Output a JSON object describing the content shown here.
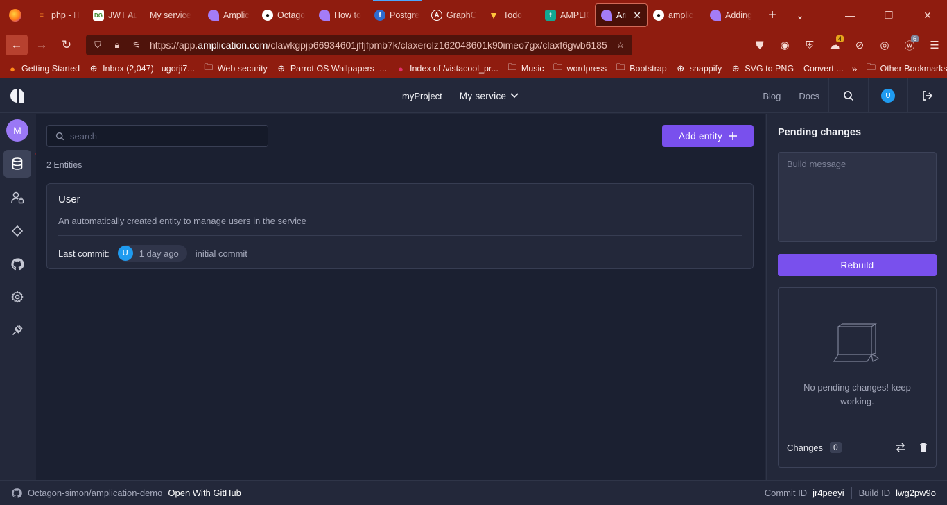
{
  "browser": {
    "tabs": [
      {
        "label": "php - H",
        "favicon": "stackoverflow-icon",
        "color": "#f48024"
      },
      {
        "label": "JWT Au",
        "favicon": "dg-icon",
        "color": "#3a8a2c"
      },
      {
        "label": "My service",
        "favicon": "none",
        "color": ""
      },
      {
        "label": "Amplic",
        "favicon": "amplication-icon",
        "color": "#a47cf7"
      },
      {
        "label": "Octago",
        "favicon": "github-icon",
        "color": "#ffffff"
      },
      {
        "label": "How to",
        "favicon": "amplication-icon",
        "color": "#a47cf7"
      },
      {
        "label": "Postgre",
        "favicon": "postgres-icon",
        "color": "#2f6cd0"
      },
      {
        "label": "GraphC",
        "favicon": "apollo-icon",
        "color": "#ffffff"
      },
      {
        "label": "Todo",
        "favicon": "vite-icon",
        "color": "#bd34fe"
      },
      {
        "label": "AMPLIC",
        "favicon": "t-icon",
        "color": "#13a892"
      },
      {
        "label": "Amp",
        "favicon": "amplication-icon",
        "color": "#a47cf7",
        "active": true
      },
      {
        "label": "amplic",
        "favicon": "github-icon",
        "color": "#ffffff"
      },
      {
        "label": "Adding",
        "favicon": "amplication-icon",
        "color": "#a47cf7"
      }
    ],
    "url_prefix": "https://app.",
    "url_host": "amplication.com",
    "url_path": "/clawkgpjp66934601jffjfpmb7k/claxerolz162048601k90imeo7gx/claxf6gwb6185",
    "extension_badges": {
      "ext3": "4",
      "ext7": "6"
    },
    "bookmarks": [
      {
        "label": "Getting Started",
        "icon": "firefox-icon"
      },
      {
        "label": "Inbox (2,047) - ugorji7...",
        "icon": "globe-icon"
      },
      {
        "label": "Web security",
        "icon": "folder-icon"
      },
      {
        "label": "Parrot OS Wallpapers -...",
        "icon": "globe-icon"
      },
      {
        "label": "Index of /vistacool_pr...",
        "icon": "berry-icon"
      },
      {
        "label": "Music",
        "icon": "folder-icon"
      },
      {
        "label": "wordpress",
        "icon": "folder-icon"
      },
      {
        "label": "Bootstrap",
        "icon": "folder-icon"
      },
      {
        "label": "snappify",
        "icon": "globe-icon"
      },
      {
        "label": "SVG to PNG – Convert ...",
        "icon": "globe-icon"
      }
    ],
    "other_bookmarks": "Other Bookmarks"
  },
  "header": {
    "project": "myProject",
    "service": "My service",
    "blog": "Blog",
    "docs": "Docs",
    "user_initial": "U"
  },
  "sidebar": {
    "workspace_initial": "M"
  },
  "main": {
    "search_placeholder": "search",
    "add_entity_label": "Add entity",
    "entity_count": "2 Entities",
    "entities": [
      {
        "name": "User",
        "description": "An automatically created entity to manage users in the service",
        "last_commit_label": "Last commit:",
        "user_initial": "U",
        "time": "1 day ago",
        "message": "initial commit"
      }
    ]
  },
  "pending": {
    "title": "Pending changes",
    "build_placeholder": "Build message",
    "rebuild_label": "Rebuild",
    "empty_text": "No pending changes! keep working.",
    "changes_label": "Changes",
    "changes_count": "0"
  },
  "footer": {
    "repo": "Octagon-simon/amplication-demo",
    "open_github": "Open With GitHub",
    "commit_label": "Commit ID",
    "commit_id": "jr4peeyi",
    "build_label": "Build ID",
    "build_id": "lwg2pw9o"
  },
  "colors": {
    "accent": "#7950ed",
    "annotation": "#e0251f"
  }
}
